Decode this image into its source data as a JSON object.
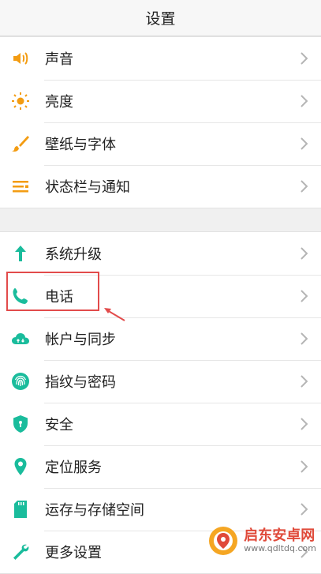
{
  "header": {
    "title": "设置"
  },
  "group1": [
    {
      "label": "声音",
      "icon": "speaker-icon",
      "color": "#f39c12"
    },
    {
      "label": "亮度",
      "icon": "sun-icon",
      "color": "#f39c12"
    },
    {
      "label": "壁纸与字体",
      "icon": "brush-icon",
      "color": "#f39c12"
    },
    {
      "label": "状态栏与通知",
      "icon": "menu-lines-icon",
      "color": "#f39c12"
    }
  ],
  "group2": [
    {
      "label": "系统升级",
      "icon": "arrow-up-icon",
      "color": "#1abc9c"
    },
    {
      "label": "电话",
      "icon": "phone-icon",
      "color": "#1abc9c"
    },
    {
      "label": "帐户与同步",
      "icon": "cloud-icon",
      "color": "#1abc9c"
    },
    {
      "label": "指纹与密码",
      "icon": "fingerprint-icon",
      "color": "#1abc9c"
    },
    {
      "label": "安全",
      "icon": "shield-icon",
      "color": "#1abc9c"
    },
    {
      "label": "定位服务",
      "icon": "location-pin-icon",
      "color": "#1abc9c"
    },
    {
      "label": "运存与存储空间",
      "icon": "sd-card-icon",
      "color": "#1abc9c"
    },
    {
      "label": "更多设置",
      "icon": "wrench-icon",
      "color": "#1abc9c"
    }
  ],
  "watermark": {
    "name": "启东安卓网",
    "url": "www.qdltdq.com"
  },
  "colors": {
    "highlight": "#e24b4b",
    "accent_orange": "#f39c12",
    "accent_teal": "#1abc9c"
  }
}
